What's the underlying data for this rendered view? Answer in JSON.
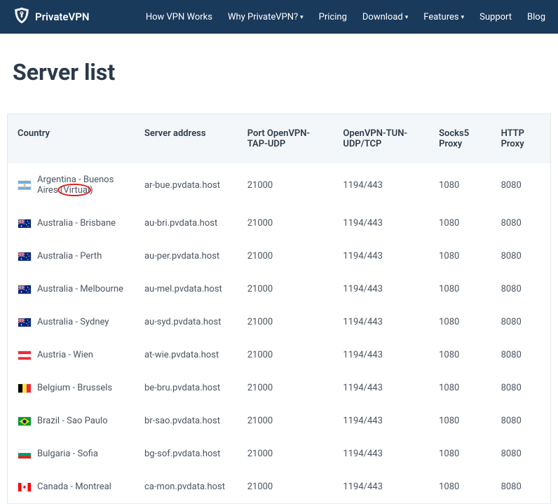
{
  "brand": {
    "name": "PrivateVPN"
  },
  "nav": {
    "items": [
      {
        "label": "How VPN Works",
        "dropdown": false
      },
      {
        "label": "Why PrivateVPN?",
        "dropdown": true
      },
      {
        "label": "Pricing",
        "dropdown": false
      },
      {
        "label": "Download",
        "dropdown": true
      },
      {
        "label": "Features",
        "dropdown": true
      },
      {
        "label": "Support",
        "dropdown": false
      },
      {
        "label": "Blog",
        "dropdown": false
      }
    ]
  },
  "page": {
    "title": "Server list"
  },
  "table": {
    "headers": {
      "country": "Country",
      "server": "Server address",
      "tap": "Port OpenVPN-TAP-UDP",
      "tun": "OpenVPN-TUN-UDP/TCP",
      "socks": "Socks5 Proxy",
      "http": "HTTP Proxy"
    },
    "rows": [
      {
        "flag": "ar",
        "country_pre": "Argentina - Buenos Aires ",
        "annot": "(Virtual)",
        "server": "ar-bue.pvdata.host",
        "tap": "21000",
        "tun": "1194/443",
        "socks": "1080",
        "http": "8080"
      },
      {
        "flag": "au",
        "country_pre": "Australia - Brisbane",
        "server": "au-bri.pvdata.host",
        "tap": "21000",
        "tun": "1194/443",
        "socks": "1080",
        "http": "8080"
      },
      {
        "flag": "au",
        "country_pre": "Australia - Perth",
        "server": "au-per.pvdata.host",
        "tap": "21000",
        "tun": "1194/443",
        "socks": "1080",
        "http": "8080"
      },
      {
        "flag": "au",
        "country_pre": "Australia - Melbourne",
        "server": "au-mel.pvdata.host",
        "tap": "21000",
        "tun": "1194/443",
        "socks": "1080",
        "http": "8080"
      },
      {
        "flag": "au",
        "country_pre": "Australia - Sydney",
        "server": "au-syd.pvdata.host",
        "tap": "21000",
        "tun": "1194/443",
        "socks": "1080",
        "http": "8080"
      },
      {
        "flag": "at",
        "country_pre": "Austria - Wien",
        "server": "at-wie.pvdata.host",
        "tap": "21000",
        "tun": "1194/443",
        "socks": "1080",
        "http": "8080"
      },
      {
        "flag": "be",
        "country_pre": "Belgium - Brussels",
        "server": "be-bru.pvdata.host",
        "tap": "21000",
        "tun": "1194/443",
        "socks": "1080",
        "http": "8080"
      },
      {
        "flag": "br",
        "country_pre": "Brazil - Sao Paulo",
        "server": "br-sao.pvdata.host",
        "tap": "21000",
        "tun": "1194/443",
        "socks": "1080",
        "http": "8080"
      },
      {
        "flag": "bg",
        "country_pre": "Bulgaria - Sofia",
        "server": "bg-sof.pvdata.host",
        "tap": "21000",
        "tun": "1194/443",
        "socks": "1080",
        "http": "8080"
      },
      {
        "flag": "ca",
        "country_pre": "Canada - Montreal",
        "server": "ca-mon.pvdata.host",
        "tap": "21000",
        "tun": "1194/443",
        "socks": "1080",
        "http": "8080"
      }
    ]
  },
  "flags": {
    "ar": "<svg viewBox='0 0 20 14'><rect width='20' height='14' fill='#74acdf'/><rect y='4.67' width='20' height='4.67' fill='#fff'/><circle cx='10' cy='7' r='1.6' fill='#f6b40e'/></svg>",
    "au": "<svg viewBox='0 0 20 14'><rect width='20' height='14' fill='#00247d'/><rect width='10' height='7' fill='#00247d'/><path d='M0 0L10 7M10 0L0 7' stroke='#fff' stroke-width='1.4'/><path d='M0 0L10 7M10 0L0 7' stroke='#cf142b' stroke-width='0.7'/><path d='M5 0V7M0 3.5H10' stroke='#fff' stroke-width='2'/><path d='M5 0V7M0 3.5H10' stroke='#cf142b' stroke-width='1'/><g fill='#fff'><circle cx='15' cy='3' r='0.7'/><circle cx='17' cy='6' r='0.7'/><circle cx='13' cy='8' r='0.7'/><circle cx='15.5' cy='11' r='0.7'/><circle cx='5' cy='10.5' r='1'/></g></svg>",
    "at": "<svg viewBox='0 0 20 14'><rect width='20' height='14' fill='#ed2939'/><rect y='4.67' width='20' height='4.67' fill='#fff'/></svg>",
    "be": "<svg viewBox='0 0 20 14'><rect width='6.67' height='14' fill='#000'/><rect x='6.67' width='6.67' height='14' fill='#fae042'/><rect x='13.33' width='6.67' height='14' fill='#ed2939'/></svg>",
    "br": "<svg viewBox='0 0 20 14'><rect width='20' height='14' fill='#009b3a'/><polygon points='10,1.5 18,7 10,12.5 2,7' fill='#fedf00'/><circle cx='10' cy='7' r='3' fill='#002776'/></svg>",
    "bg": "<svg viewBox='0 0 20 14'><rect width='20' height='4.67' fill='#fff'/><rect y='4.67' width='20' height='4.67' fill='#00966e'/><rect y='9.33' width='20' height='4.67' fill='#d62612'/></svg>",
    "ca": "<svg viewBox='0 0 20 14'><rect width='20' height='14' fill='#fff'/><rect width='5' height='14' fill='#ff0000'/><rect x='15' width='5' height='14' fill='#ff0000'/><path d='M10 3 L10.6 5 L12 4.5 L11.3 6.3 L13 6.6 L11.2 7.6 L11.8 9 L10 8 L8.2 9 L8.8 7.6 L7 6.6 L8.7 6.3 L8 4.5 L9.4 5 Z' fill='#ff0000'/></svg>"
  }
}
